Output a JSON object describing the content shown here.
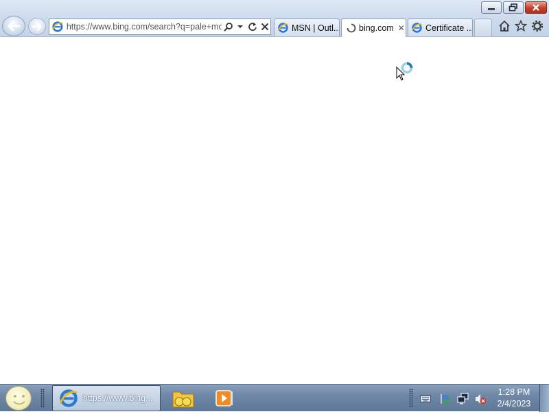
{
  "browser": {
    "address_url": "https://www.bing.com/search?q=pale+mo",
    "tabs": [
      {
        "label": "MSN | Outl...",
        "icon": "ie-icon"
      },
      {
        "label": "bing.com",
        "icon": "loading-spinner-icon",
        "active": true,
        "close": "✕"
      },
      {
        "label": "Certificate ...",
        "icon": "ie-icon"
      }
    ]
  },
  "taskbar": {
    "ie_button_label": "https://www.bing...",
    "clock": {
      "time": "1:28 PM",
      "date": "2/4/2023"
    }
  },
  "colors": {
    "chrome": "#cfdced",
    "taskbar": "#6f88a7",
    "close_button": "#c4402a"
  }
}
